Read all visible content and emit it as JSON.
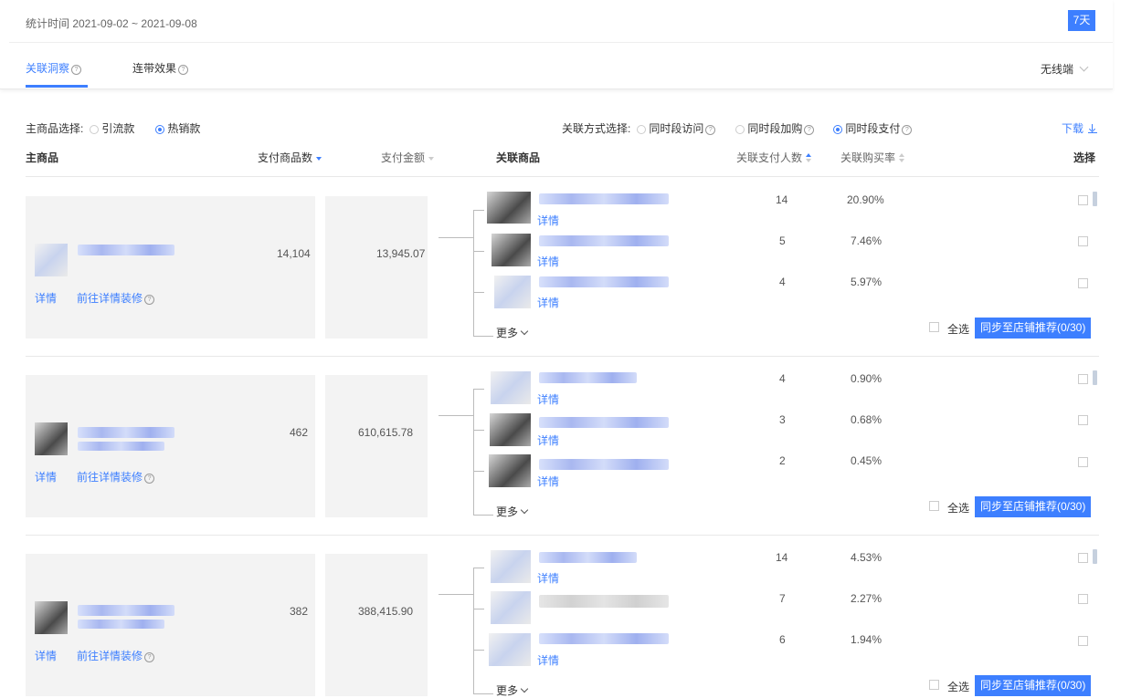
{
  "header": {
    "date_range": "统计时间 2021-09-02 ~ 2021-09-08",
    "period_button": "7天",
    "tabs": [
      {
        "label": "关联洞察",
        "active": true
      },
      {
        "label": "连带效果",
        "active": false
      }
    ],
    "device_select": "无线端"
  },
  "filters": {
    "main_product_label": "主商品选择:",
    "main_options": [
      {
        "label": "引流款",
        "selected": false
      },
      {
        "label": "热销款",
        "selected": true
      }
    ],
    "relation_label": "关联方式选择:",
    "relation_options": [
      {
        "label": "同时段访问",
        "selected": false
      },
      {
        "label": "同时段加购",
        "selected": false
      },
      {
        "label": "同时段支付",
        "selected": true
      }
    ],
    "download": "下载"
  },
  "columns": {
    "main_product": "主商品",
    "paid_items": "支付商品数",
    "paid_amount": "支付金额",
    "related_product": "关联商品",
    "related_buyers": "关联支付人数",
    "related_rate": "关联购买率",
    "select": "选择"
  },
  "rows": [
    {
      "detail": "详情",
      "decorate": "前往详情装修",
      "paid_items": "14,104",
      "paid_amount": "13,945.07",
      "related": [
        {
          "detail": "详情",
          "buyers": "14",
          "rate": "20.90%"
        },
        {
          "detail": "详情",
          "buyers": "5",
          "rate": "7.46%"
        },
        {
          "detail": "详情",
          "buyers": "4",
          "rate": "5.97%"
        }
      ],
      "more": "更多",
      "select_all": "全选",
      "sync": "同步至店铺推荐(0/30)"
    },
    {
      "detail": "详情",
      "decorate": "前往详情装修",
      "paid_items": "462",
      "paid_amount": "610,615.78",
      "related": [
        {
          "detail": "详情",
          "buyers": "4",
          "rate": "0.90%"
        },
        {
          "detail": "详情",
          "buyers": "3",
          "rate": "0.68%"
        },
        {
          "detail": "详情",
          "buyers": "2",
          "rate": "0.45%"
        }
      ],
      "more": "更多",
      "select_all": "全选",
      "sync": "同步至店铺推荐(0/30)"
    },
    {
      "detail": "详情",
      "decorate": "前往详情装修",
      "paid_items": "382",
      "paid_amount": "388,415.90",
      "related": [
        {
          "detail": "详情",
          "buyers": "14",
          "rate": "4.53%"
        },
        {
          "detail": "",
          "buyers": "7",
          "rate": "2.27%"
        },
        {
          "detail": "详情",
          "buyers": "6",
          "rate": "1.94%"
        }
      ],
      "more": "更多",
      "select_all": "全选",
      "sync": "同步至店铺推荐(0/30)"
    }
  ],
  "colors": {
    "accent": "#3d7fff"
  }
}
